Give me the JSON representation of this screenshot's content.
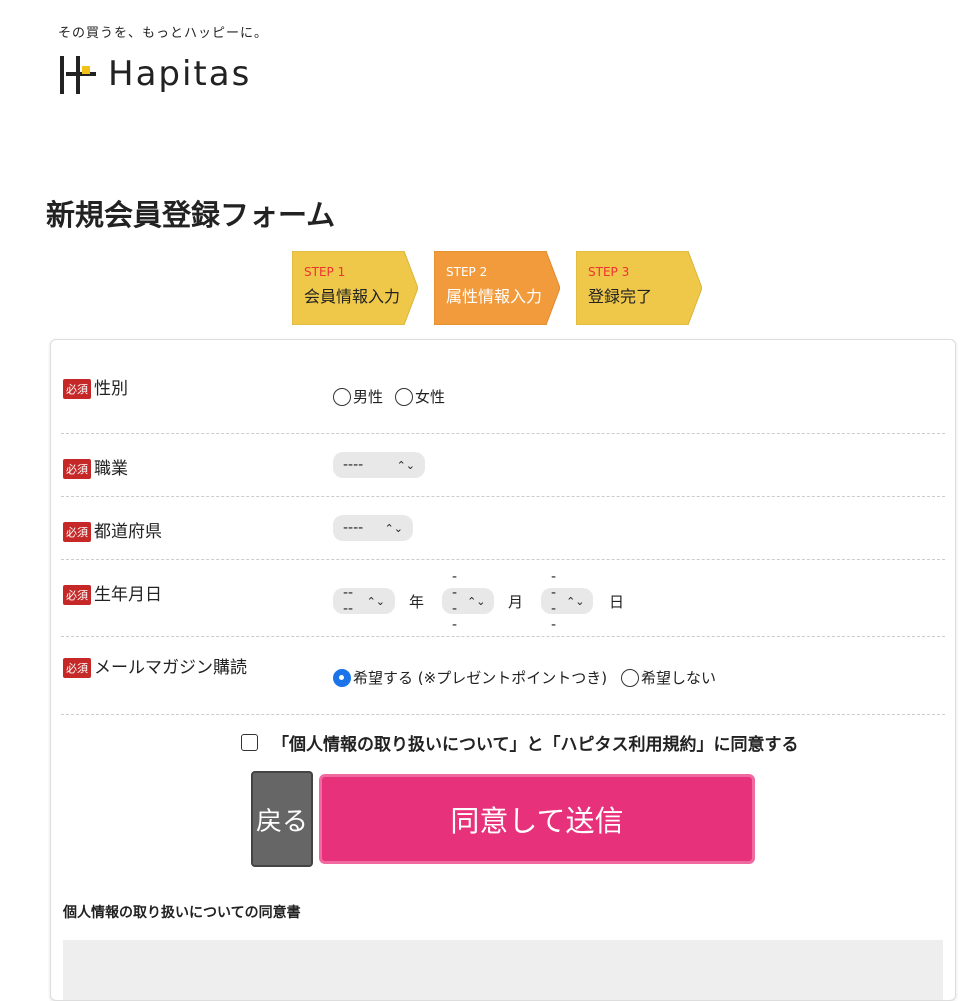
{
  "header": {
    "tagline": "その買うを、もっとハッピーに。",
    "logo_text": "Hapitas"
  },
  "page_title": "新規会員登録フォーム",
  "steps": [
    {
      "step": "STEP 1",
      "name": "会員情報入力",
      "color": "#efc84a",
      "current": false
    },
    {
      "step": "STEP 2",
      "name": "属性情報入力",
      "color": "#f29b3c",
      "current": true
    },
    {
      "step": "STEP 3",
      "name": "登録完了",
      "color": "#efc84a",
      "current": false
    }
  ],
  "form": {
    "required_badge": "必須",
    "gender": {
      "label": "性別",
      "options": [
        "男性",
        "女性"
      ]
    },
    "occupation": {
      "label": "職業",
      "value": "----"
    },
    "prefecture": {
      "label": "都道府県",
      "value": "----"
    },
    "birthdate": {
      "label": "生年月日",
      "year": "----",
      "year_unit": "年",
      "month": "----",
      "month_unit": "月",
      "day": "----",
      "day_unit": "日"
    },
    "newsletter": {
      "label": "メールマガジン購読",
      "option_yes": "希望する (※プレゼントポイントつき)",
      "option_no": "希望しない",
      "selected": "yes"
    },
    "agree_text": "「個人情報の取り扱いについて」と「ハピタス利用規約」に同意する",
    "back_label": "戻る",
    "submit_label": "同意して送信",
    "consent_heading": "個人情報の取り扱いについての同意書"
  },
  "colors": {
    "accent": "#e8317b",
    "required": "#c62828",
    "radio_selected": "#1a73e8"
  }
}
